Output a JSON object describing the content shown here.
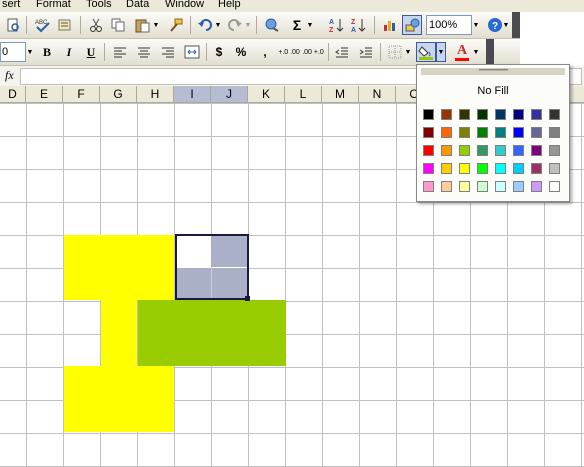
{
  "menu": [
    "sert",
    "Format",
    "Tools",
    "Data",
    "Window",
    "Help"
  ],
  "toolbar": {
    "zoom": "100%",
    "font_size": "0",
    "bold": "B",
    "italic": "I",
    "underline": "U",
    "currency": "$",
    "percent": "%",
    "comma": ",",
    "inc_decimal": "+.0 .00",
    "dec_decimal": ".00 +.0",
    "font_color_letter": "A",
    "help_symbol": "?"
  },
  "formula_bar": {
    "fx": "fx",
    "content": ""
  },
  "columns": [
    "D",
    "E",
    "F",
    "G",
    "H",
    "I",
    "J",
    "K",
    "L",
    "M",
    "N",
    "O"
  ],
  "selected_columns": [
    "I",
    "J"
  ],
  "colors": {
    "yellow": "#ffff00",
    "olive_green": "#99cc00",
    "selection_tint": "#a9b0c8",
    "selection_border": "#1a1a40"
  },
  "fill_popup": {
    "no_fill_label": "No Fill",
    "palette": [
      [
        "#000000",
        "#993300",
        "#333300",
        "#003300",
        "#003366",
        "#000080",
        "#333399",
        "#333333"
      ],
      [
        "#800000",
        "#ff6600",
        "#808000",
        "#008000",
        "#008080",
        "#0000ff",
        "#666699",
        "#808080"
      ],
      [
        "#ff0000",
        "#ff9900",
        "#99cc00",
        "#339966",
        "#33cccc",
        "#3366ff",
        "#800080",
        "#969696"
      ],
      [
        "#ff00ff",
        "#ffcc00",
        "#ffff00",
        "#00ff00",
        "#00ffff",
        "#00ccff",
        "#993366",
        "#c0c0c0"
      ],
      [
        "#ff99cc",
        "#ffcc99",
        "#ffff99",
        "#ccffcc",
        "#ccffff",
        "#99ccff",
        "#cc99ff",
        "#ffffff"
      ]
    ]
  }
}
